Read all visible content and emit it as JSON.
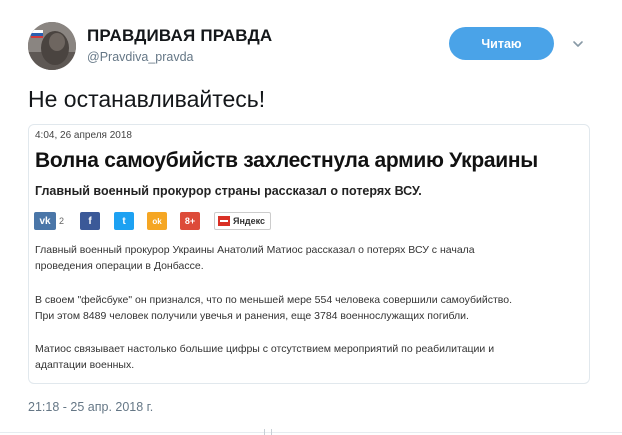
{
  "tweet": {
    "author": {
      "display_name": "ПРАВДИВАЯ ПРАВДА",
      "handle": "@Pravdiva_pravda"
    },
    "follow_label": "Читаю",
    "text": "Не останавливайтесь!",
    "timestamp": "21:18 - 25 апр. 2018 г."
  },
  "article": {
    "date": "4:04, 26 апреля 2018",
    "title": "Волна самоубийств захлестнула армию Украины",
    "subtitle": "Главный военный прокурор страны рассказал о потерях ВСУ.",
    "share": {
      "vk_label": "vk",
      "vk_count": "2",
      "fb_label": "f",
      "tw_label": "t",
      "ok_label": "ok",
      "gplus_label": "8+",
      "yandex_label": "Яндекс"
    },
    "paragraphs": [
      [
        "Главный военный прокурор Украины Анатолий Матиос рассказал о потерях ВСУ с начала",
        "проведения операции в Донбассе."
      ],
      [
        "В своем \"фейсбуке\" он признался, что по меньшей мере 554 человека совершили самоубийство.",
        "При этом 8489 человек получили увечья и ранения, еще 3784 военнослужащих погибли."
      ],
      [
        "Матиос связывает настолько большие цифры с отсутствием мероприятий по реабилитации и",
        "адаптации военных."
      ]
    ]
  },
  "colors": {
    "follow_bg": "#4aa3e8",
    "vk": "#4a76a8",
    "facebook": "#3b5998",
    "twitter": "#1da1f2",
    "odnoklassniki": "#f5a623",
    "gplus": "#dd4b39",
    "yandex": "#d93025",
    "muted_text": "#657786"
  }
}
